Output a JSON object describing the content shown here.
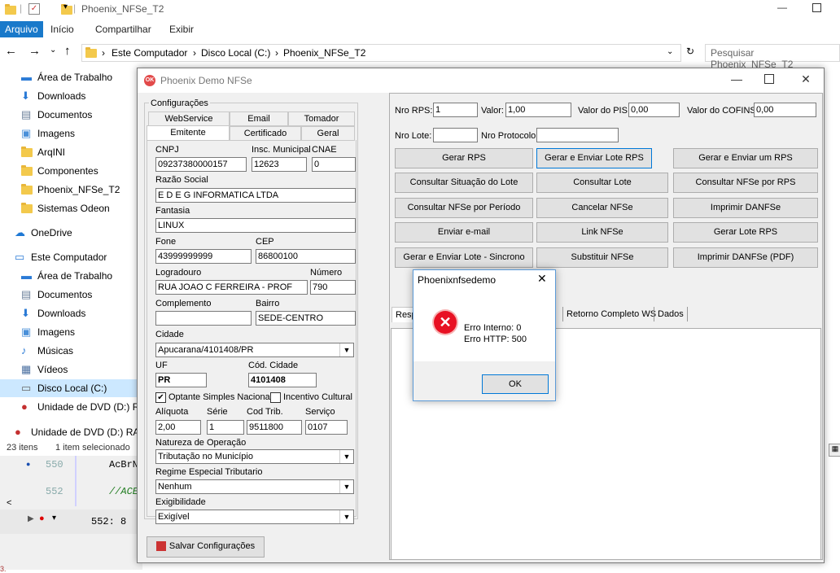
{
  "explorer": {
    "title": "Phoenix_NFSe_T2",
    "ribbon_tabs": [
      "Arquivo",
      "Início",
      "Compartilhar",
      "Exibir"
    ],
    "breadcrumb": [
      "Este Computador",
      "Disco Local (C:)",
      "Phoenix_NFSe_T2"
    ],
    "search_placeholder": "Pesquisar Phoenix_NFSe_T2",
    "nav_items": [
      {
        "label": "Área de Trabalho",
        "icon": "desktop-icon"
      },
      {
        "label": "Downloads",
        "icon": "download-arrow-icon"
      },
      {
        "label": "Documentos",
        "icon": "document-icon"
      },
      {
        "label": "Imagens",
        "icon": "pictures-icon"
      },
      {
        "label": "ArqINI",
        "icon": "folder-icon"
      },
      {
        "label": "Componentes",
        "icon": "folder-icon"
      },
      {
        "label": "Phoenix_NFSe_T2",
        "icon": "folder-icon"
      },
      {
        "label": "Sistemas Odeon",
        "icon": "folder-icon"
      },
      {
        "label": "OneDrive",
        "icon": "cloud-icon"
      },
      {
        "label": "Este Computador",
        "icon": "computer-icon"
      },
      {
        "label": "Área de Trabalho",
        "icon": "desktop-icon"
      },
      {
        "label": "Documentos",
        "icon": "document-icon"
      },
      {
        "label": "Downloads",
        "icon": "download-arrow-icon"
      },
      {
        "label": "Imagens",
        "icon": "pictures-icon"
      },
      {
        "label": "Músicas",
        "icon": "music-icon"
      },
      {
        "label": "Vídeos",
        "icon": "video-icon"
      },
      {
        "label": "Disco Local (C:)",
        "icon": "drive-icon"
      },
      {
        "label": "Unidade de DVD (D:) RAD",
        "icon": "dvd-icon"
      },
      {
        "label": "Unidade de DVD (D:) RADS",
        "icon": "dvd-icon"
      }
    ],
    "status_items": "23 itens",
    "status_selected": "1 item selecionado"
  },
  "ide": {
    "line1": "550",
    "code1": "AcBrN",
    "line2": "552",
    "code2": "//ACE",
    "position": "552:  8",
    "col1": "1"
  },
  "app": {
    "title": "Phoenix Demo NFSe",
    "config_group": "Configurações",
    "tabs_row1": [
      "WebService",
      "Email",
      "Tomador"
    ],
    "tabs_row2": [
      "Emitente",
      "Certificado",
      "Geral"
    ],
    "fields": {
      "cnpj_label": "CNPJ",
      "cnpj": "09237380000157",
      "im_label": "Insc. Municipal",
      "im": "12623",
      "cnae_label": "CNAE",
      "cnae": "0",
      "razao_label": "Razão Social",
      "razao": "E D E G INFORMATICA LTDA",
      "fantasia_label": "Fantasia",
      "fantasia": "LINUX",
      "fone_label": "Fone",
      "fone": "43999999999",
      "cep_label": "CEP",
      "cep": "86800100",
      "logradouro_label": "Logradouro",
      "logradouro": "RUA JOAO C FERREIRA - PROF",
      "numero_label": "Número",
      "numero": "790",
      "complemento_label": "Complemento",
      "complemento": "",
      "bairro_label": "Bairro",
      "bairro": "SEDE-CENTRO",
      "cidade_label": "Cidade",
      "cidade": "Apucarana/4101408/PR",
      "uf_label": "UF",
      "uf": "PR",
      "cod_cidade_label": "Cód. Cidade",
      "cod_cidade": "4101408",
      "optante_label": "Optante Simples Nacional",
      "incentivo_label": "Incentivo Cultural",
      "aliquota_label": "Alíquota",
      "aliquota": "2,00",
      "serie_label": "Série",
      "serie": "1",
      "codtrib_label": "Cod Trib.",
      "codtrib": "9511800",
      "servico_label": "Serviço",
      "servico": "0107",
      "natureza_label": "Natureza de Operação",
      "natureza": "Tributação no Município",
      "regime_label": "Regime Especial Tributario",
      "regime": "Nenhum",
      "exig_label": "Exigibilidade",
      "exig": "Exigível"
    },
    "save_button": "Salvar Configurações",
    "right": {
      "nro_rps_label": "Nro RPS:",
      "nro_rps": "1",
      "valor_label": "Valor:",
      "valor": "1,00",
      "pis_label": "Valor do PIS:",
      "pis": "0,00",
      "cofins_label": "Valor do COFINS:",
      "cofins": "0,00",
      "nro_lote_label": "Nro Lote:",
      "nro_lote": "",
      "nro_protocolo_label": "Nro Protocolo:",
      "nro_protocolo": ""
    },
    "buttons": [
      [
        "Gerar RPS",
        "Gerar e Enviar Lote RPS",
        "Gerar e Enviar um RPS"
      ],
      [
        "Consultar Situação do Lote",
        "Consultar Lote",
        "Consultar NFSe por RPS"
      ],
      [
        "Consultar NFSe por Período",
        "Cancelar NFSe",
        "Imprimir DANFSe"
      ],
      [
        "Enviar e-mail",
        "Link NFSe",
        "Gerar Lote RPS"
      ],
      [
        "Gerar e Enviar Lote - Sincrono",
        "Substituir NFSe",
        "Imprimir DANFSe (PDF)"
      ]
    ],
    "bottom_tabs": [
      "Resp",
      "e",
      "Retorno Completo WS",
      "Dados"
    ]
  },
  "dialog": {
    "title": "Phoenixnfsedemo",
    "line1": "Erro Interno: 0",
    "line2": "Erro HTTP: 500",
    "ok": "OK"
  },
  "colors": {
    "accent": "#1979ca",
    "error": "#e81123",
    "dialog_border": "#5c9bd8"
  }
}
